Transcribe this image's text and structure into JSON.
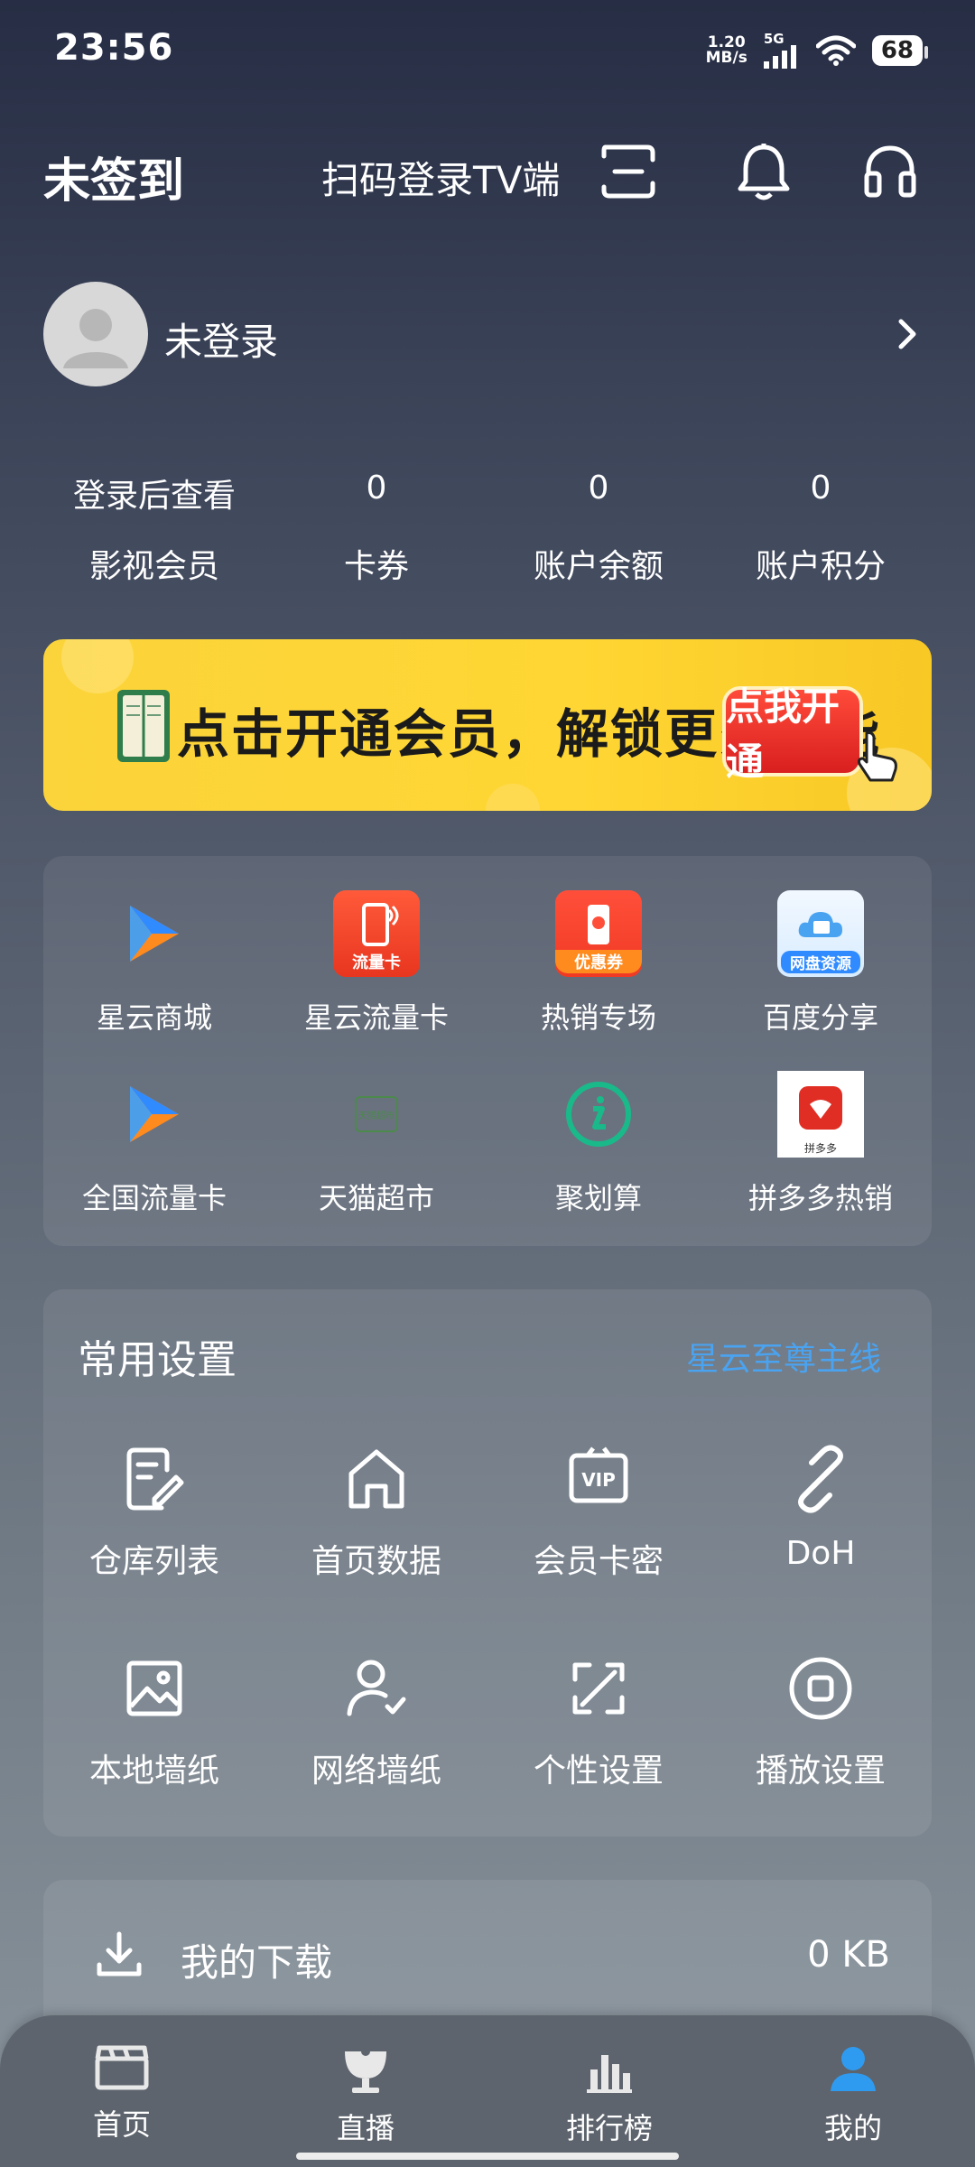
{
  "status": {
    "time": "23:56",
    "net_speed_value": "1.20",
    "net_speed_unit": "MB/s",
    "network": "5G",
    "battery": "68"
  },
  "header": {
    "sign_status": "未签到",
    "scan_login": "扫码登录TV端"
  },
  "profile": {
    "name": "未登录"
  },
  "stats": [
    {
      "value": "登录后查看",
      "label": "影视会员"
    },
    {
      "value": "0",
      "label": "卡券"
    },
    {
      "value": "0",
      "label": "账户余额"
    },
    {
      "value": "0",
      "label": "账户积分"
    }
  ],
  "banner": {
    "text": "点击开通会员，解锁更多功能",
    "button": "点我开通"
  },
  "apps": [
    {
      "label": "星云商城",
      "icon": "play-logo-icon"
    },
    {
      "label": "星云流量卡",
      "icon": "traffic-card-icon",
      "badge": "流量卡"
    },
    {
      "label": "热销专场",
      "icon": "coupon-icon",
      "badge": "优惠券"
    },
    {
      "label": "百度分享",
      "icon": "cloud-drive-icon",
      "badge": "网盘资源"
    },
    {
      "label": "全国流量卡",
      "icon": "play-logo-icon"
    },
    {
      "label": "天猫超市",
      "icon": "tmall-icon",
      "badge": "天猫超市"
    },
    {
      "label": "聚划算",
      "icon": "juhuasuan-icon"
    },
    {
      "label": "拼多多热销",
      "icon": "pinduoduo-icon",
      "badge": "拼多多"
    }
  ],
  "settings": {
    "title": "常用设置",
    "link": "星云至尊主线",
    "items": [
      {
        "label": "仓库列表",
        "icon": "edit-doc-icon"
      },
      {
        "label": "首页数据",
        "icon": "home-icon"
      },
      {
        "label": "会员卡密",
        "icon": "vip-icon"
      },
      {
        "label": "DoH",
        "icon": "link-icon"
      },
      {
        "label": "本地墙纸",
        "icon": "image-icon"
      },
      {
        "label": "网络墙纸",
        "icon": "user-check-icon"
      },
      {
        "label": "个性设置",
        "icon": "expand-icon"
      },
      {
        "label": "播放设置",
        "icon": "stop-circle-icon"
      }
    ]
  },
  "download": {
    "label": "我的下载",
    "size": "0 KB"
  },
  "nav": [
    {
      "label": "首页",
      "icon": "clapperboard-icon",
      "active": false
    },
    {
      "label": "直播",
      "icon": "satellite-icon",
      "active": false
    },
    {
      "label": "排行榜",
      "icon": "bar-chart-icon",
      "active": false
    },
    {
      "label": "我的",
      "icon": "person-icon",
      "active": true
    }
  ],
  "colors": {
    "accent": "#4aa3f0",
    "active_nav": "#2f9bf0",
    "banner_bg": "#fbd43b"
  }
}
